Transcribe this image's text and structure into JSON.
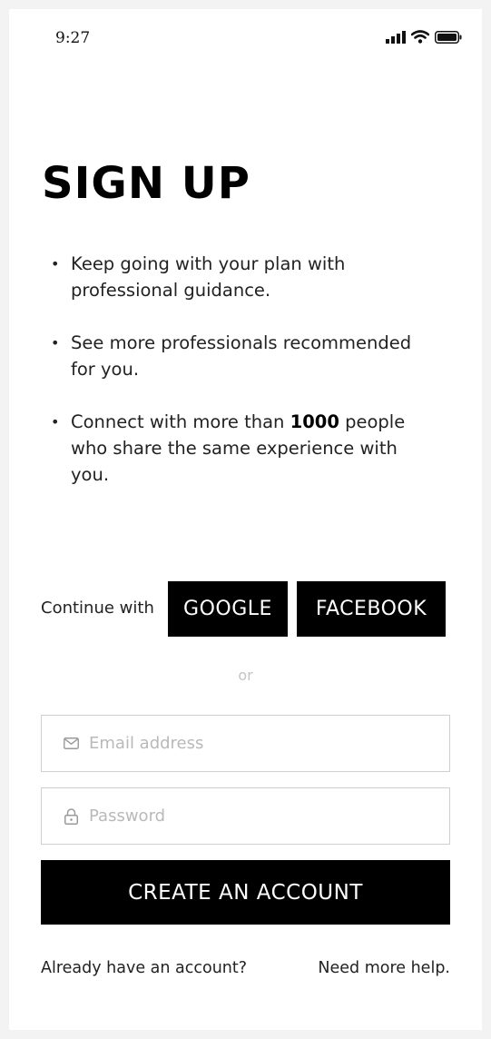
{
  "status_bar": {
    "time": "9:27",
    "icons": [
      "signal-icon",
      "wifi-icon",
      "battery-icon"
    ]
  },
  "title": "SIGN UP",
  "bullets": [
    {
      "text": "Keep going with your plan with professional guidance."
    },
    {
      "text": "See more professionals recommended for you."
    },
    {
      "before": "Connect with more than ",
      "bold": "1000",
      "after": " people who share the same experience with you."
    }
  ],
  "social": {
    "continue_label": "Continue with",
    "google_label": "GOOGLE",
    "facebook_label": "FACEBOOK"
  },
  "or_label": "or",
  "form": {
    "email_placeholder": "Email address",
    "email_value": "",
    "email_icon": "mail-icon",
    "password_placeholder": "Password",
    "password_value": "",
    "password_icon": "lock-icon",
    "submit_label": "CREATE AN ACCOUNT"
  },
  "footer": {
    "login_link": "Already have an account?",
    "help_link": "Need more help."
  },
  "colors": {
    "primary": "#000000",
    "background": "#ffffff",
    "text": "#222222",
    "muted": "#c4c4c4",
    "border": "#cfcfcf"
  }
}
